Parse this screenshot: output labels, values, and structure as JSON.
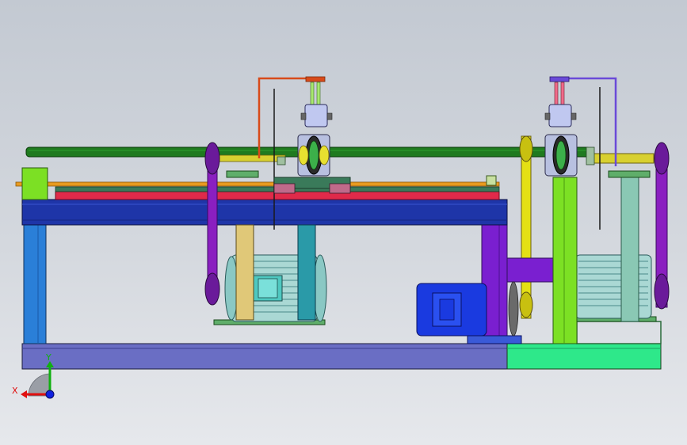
{
  "viewport": {
    "background_top": "#c3c9d2",
    "background_bottom": "#e6e8ec"
  },
  "triad": {
    "x_label": "X",
    "y_label": "Y",
    "x_color": "#e01010",
    "y_color": "#10b010",
    "z_color": "#1020e0"
  },
  "colors": {
    "frame_top_beam": "#1e35a8",
    "frame_left_leg": "#2a7fd8",
    "frame_bottom_left": "#6a6ec4",
    "frame_bottom_right": "#2ee88a",
    "shaft": "#1f7a1f",
    "belt_purple": "#8a1fc0",
    "belt_yellow": "#e4e014",
    "motor_body": "#4fc8c0",
    "motor_blue": "#1a3ae0",
    "post_green": "#7ce024",
    "post_teal": "#5fae92"
  }
}
